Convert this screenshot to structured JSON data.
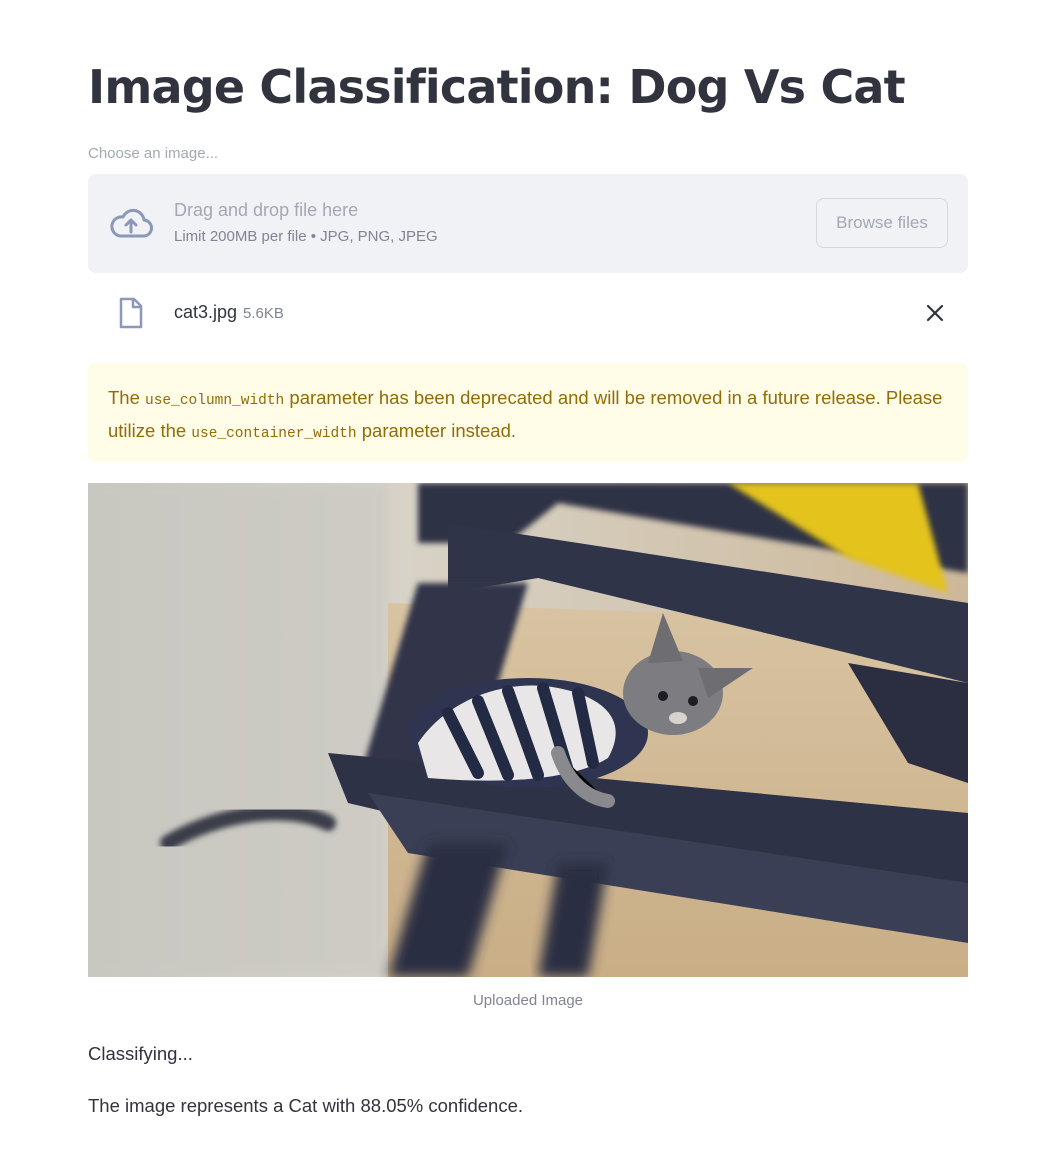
{
  "title": "Image Classification: Dog Vs Cat",
  "uploader": {
    "label": "Choose an image...",
    "drop_text": "Drag and drop file here",
    "limit_text": "Limit 200MB per file • JPG, PNG, JPEG",
    "browse_label": "Browse files"
  },
  "file": {
    "name": "cat3.jpg",
    "size": "5.6KB"
  },
  "warning": {
    "part1": "The ",
    "code1": "use_column_width",
    "part2": " parameter has been deprecated and will be removed in a future release. Please utilize the ",
    "code2": "use_container_width",
    "part3": " parameter instead."
  },
  "image": {
    "caption": "Uploaded Image"
  },
  "status_text": "Classifying...",
  "result_text": "The image represents a Cat with 88.05% confidence.",
  "icons": {
    "upload": "cloud-upload-icon",
    "file": "file-icon",
    "close": "close-icon"
  },
  "colors": {
    "text": "#31333f",
    "muted": "#808495",
    "dropzone_bg": "#f0f2f6",
    "warning_bg": "#fffce7",
    "warning_text": "#926c05"
  }
}
